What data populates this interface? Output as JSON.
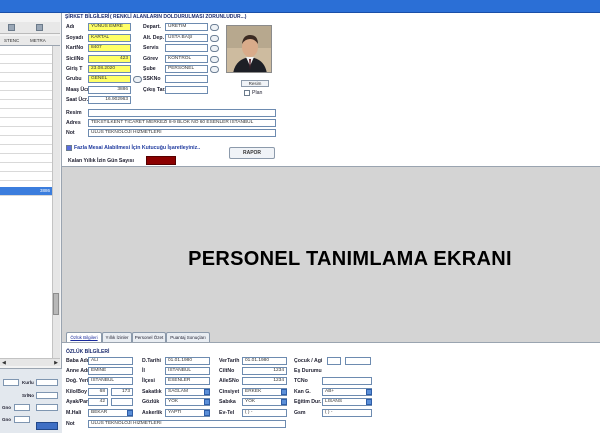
{
  "left_pane": {
    "columns": [
      "STENC",
      "METRA"
    ],
    "selected_row_value": "3886",
    "bottom_labels": [
      "Kurlu",
      "SrlNo",
      "Gno",
      "Gno"
    ]
  },
  "form": {
    "section_title": "ŞİRKET BİLGİLERİ",
    "section_note": "( RENKLİ ALANLARIN DOLDURULMASI ZORUNLUDUR...)",
    "labels": {
      "adi": "Adı",
      "soyadi": "Soyadı",
      "kartno": "KartNo",
      "sicilno": "SicilNo",
      "giris_t": "Giriş T",
      "grubu": "Grubu",
      "maas_ucr": "Maaş Ücr.",
      "saat_ucr": "Saat Ücr.",
      "depart": "Depart.",
      "alt_dep": "Alt. Dep.",
      "servis": "Servis",
      "gorev": "Görev",
      "sube": "Şube",
      "sskno": "SSKNo",
      "cikis_tar": "Çıkış Tar.",
      "resim": "Resim",
      "adres": "Adres",
      "not": "Not"
    },
    "values": {
      "adi": "YUNUS EMRE",
      "soyadi": "KARTAL",
      "kartno": "8407",
      "sicilno": "423",
      "giris_t": "23.08.2020",
      "grubu": "GENEL",
      "maas_ucr": "3886",
      "saat_ucr": "16.902963",
      "depart": "ÜRETİM",
      "alt_dep": "USTA BAŞI",
      "servis": "",
      "gorev": "KONTROL",
      "sube": "PERSONEL",
      "sskno": "",
      "cikis_tar": "",
      "resim": "",
      "adres": "TEKSTİLKENT TİCARET MERKEZİ 8-9 BLOK NO 60 ESENLER İSTANBUL",
      "not": "ULUS TEKNOLOJİ HİZMETLERİ"
    },
    "photo_button": "Resim",
    "plan_label": "Plan",
    "overtime_checkbox_label": "Fazla Mesai Alabilmesi İçin Kutucuğu İşaretleyiniz..",
    "remaining_leave_label": "Kalan Yıllık İzin Gün Sayısı",
    "report_button": "RAPOR"
  },
  "main_title": "PERSONEL TANIMLAMA EKRANI",
  "tabs": [
    "Özlük Bilgileri",
    "Yıllık İzinler",
    "Personel Özet",
    "Puantaj Sonuçları"
  ],
  "ozluk": {
    "section_title": "ÖZLÜK BİLGİLERİ",
    "labels": {
      "baba_adi": "Baba Adı",
      "anne_adi": "Anne Adı",
      "dog_yeri": "Doğ. Yeri",
      "kilo_boy": "Kilo/Boy",
      "ayak_pan": "Ayak/Pan",
      "m_hali": "M.Hali",
      "not": "Not",
      "d_tarihi": "D.Tarihi",
      "il": "İl",
      "ilcesi": "İlçesi",
      "sakatlik": "Sakatlık",
      "gozluk": "Gözlük",
      "askerlik": "Askerlik",
      "ver_tarih": "VerTarih",
      "cilt_no": "CiltNo",
      "aile_sno": "AileSNo",
      "cinsiyet": "Cinsiyet",
      "sabika": "Sabıka",
      "ev_tel": "Ev-Tel",
      "cocuk_ag": "Çocuk / Agi",
      "es_durumu": "Eş Durumu",
      "tc_no": "TCNo",
      "kan_g": "Kan G.",
      "egitim_dur": "Eğitim Dur.",
      "gsm": "Gsm"
    },
    "values": {
      "baba_adi": "ALİ",
      "anne_adi": "EMİNE",
      "dog_yeri": "İSTANBUL",
      "kilo": "68",
      "boy": "173",
      "ayak": "42",
      "m_hali": "BEKAR",
      "not": "ULUS TEKNOLOJİ HİZMETLERİ",
      "d_tarihi": "01.01.1980",
      "il": "İSTANBUL",
      "ilcesi": "ESENLER",
      "sakatlik": "SAĞLAM",
      "gozluk": "YOK",
      "askerlik": "YAPTI",
      "ver_tarih": "01.01.1980",
      "cilt_no": "1234",
      "aile_sno": "1234",
      "cinsiyet": "ERKEK",
      "sabika": "YOK",
      "ev_tel": "( ) -",
      "kan_g": "AB+",
      "egitim_dur": "LİSANS",
      "gsm": "( ) -"
    }
  },
  "colors": {
    "title_bar": "#2b6fd6",
    "required_field": "#ffff66",
    "selected_row": "#3b7ddd",
    "leave_box": "#8b0000"
  }
}
